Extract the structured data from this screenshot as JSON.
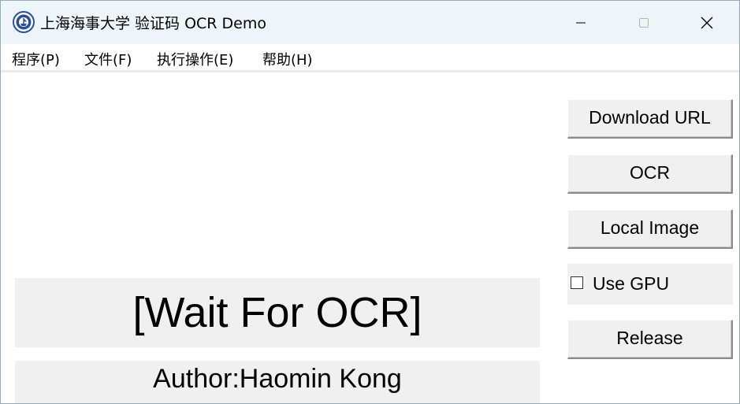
{
  "window": {
    "title": "上海海事大学 验证码 OCR Demo",
    "controls": {
      "minimize": "minimize",
      "maximize": "maximize",
      "close": "close"
    }
  },
  "menu": {
    "items": [
      {
        "label": "程序(P)"
      },
      {
        "label": "文件(F)"
      },
      {
        "label": "执行操作(E)"
      },
      {
        "label": "帮助(H)"
      }
    ]
  },
  "result": {
    "text": "[Wait For OCR]"
  },
  "author": {
    "text": "Author:Haomin Kong"
  },
  "buttons": {
    "download": "Download URL",
    "ocr": "OCR",
    "local_image": "Local Image",
    "release": "Release"
  },
  "gpu": {
    "label": "Use GPU",
    "checked": false
  },
  "icons": {
    "app": "university-emblem-icon"
  }
}
